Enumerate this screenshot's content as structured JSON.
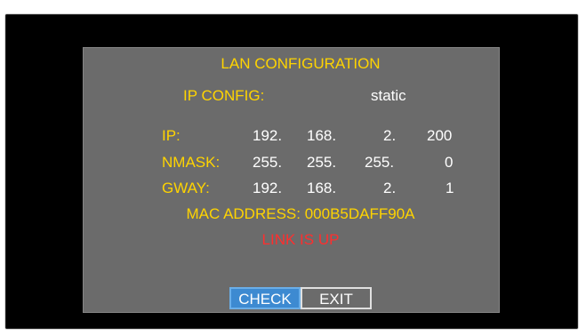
{
  "title": "LAN CONFIGURATION",
  "ip_config": {
    "label": "IP CONFIG:",
    "value": "static"
  },
  "rows": [
    {
      "label": "IP:",
      "octets": [
        "192.",
        "168.",
        "2.",
        "200"
      ]
    },
    {
      "label": "NMASK:",
      "octets": [
        "255.",
        "255.",
        "255.",
        "0"
      ]
    },
    {
      "label": "GWAY:",
      "octets": [
        "192.",
        "168.",
        "2.",
        "1"
      ]
    }
  ],
  "mac": "MAC ADDRESS: 000B5DAFF90A",
  "link_status": "LINK IS UP",
  "buttons": {
    "check": "CHECK",
    "exit": "EXIT"
  },
  "colors": {
    "label": "#ffd400",
    "value": "#ffffff",
    "status": "#ff2e2e",
    "screen": "#6b6b6b",
    "selected_button": "#3d8ad1"
  }
}
